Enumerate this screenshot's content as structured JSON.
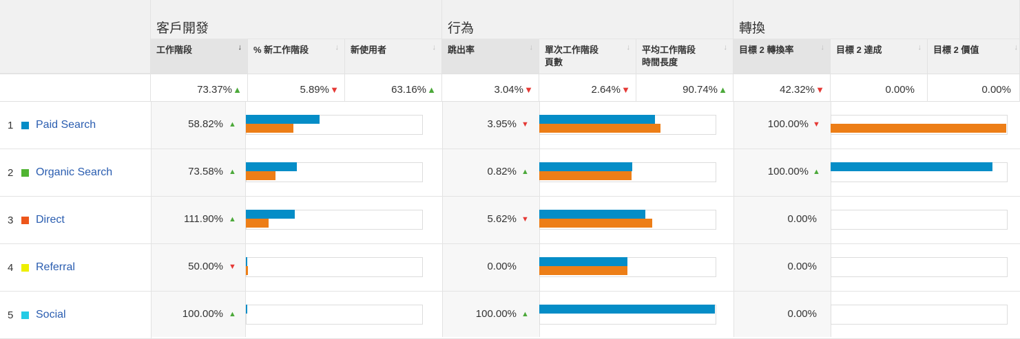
{
  "groups": {
    "acquisition": "客戶開發",
    "behavior": "行為",
    "conversions": "轉換"
  },
  "columns": {
    "sessions": "工作階段",
    "new_sessions_pct": "% 新工作階段",
    "new_users": "新使用者",
    "bounce_rate": "跳出率",
    "pages_per_session": "單次工作階段\n頁數",
    "avg_session_duration": "平均工作階段\n時間長度",
    "goal2_conv_rate": "目標 2 轉換率",
    "goal2_completions": "目標 2 達成",
    "goal2_value": "目標 2 價值"
  },
  "sort_icons": {
    "active": "↓",
    "inactive": "↓"
  },
  "totals": {
    "sessions": "73.37%",
    "sessions_dir": "up",
    "new_sessions_pct": "5.89%",
    "new_sessions_pct_dir": "down",
    "new_users": "63.16%",
    "new_users_dir": "up",
    "bounce_rate": "3.04%",
    "bounce_rate_dir": "down",
    "pages_per_session": "2.64%",
    "pages_per_session_dir": "down",
    "avg_session_duration": "90.74%",
    "avg_session_duration_dir": "up",
    "goal2_conv_rate": "42.32%",
    "goal2_conv_rate_dir": "down",
    "goal2_completions": "0.00%",
    "goal2_value": "0.00%"
  },
  "rows": [
    {
      "index": "1",
      "name": "Paid Search",
      "color": "#058dc7",
      "sessions": "58.82%",
      "sessions_dir": "up",
      "new_sessions_bars": [
        0.42,
        0.27
      ],
      "bounce": "3.95%",
      "bounce_dir": "down",
      "behavior_bars": [
        0.66,
        0.69
      ],
      "conv": "100.00%",
      "conv_dir": "down",
      "goal_bars": [
        0,
        1.0
      ]
    },
    {
      "index": "2",
      "name": "Organic Search",
      "color": "#50b432",
      "sessions": "73.58%",
      "sessions_dir": "up",
      "new_sessions_bars": [
        0.29,
        0.17
      ],
      "bounce": "0.82%",
      "bounce_dir": "up",
      "behavior_bars": [
        0.53,
        0.525
      ],
      "conv": "100.00%",
      "conv_dir": "up",
      "goal_bars": [
        0.92,
        0
      ]
    },
    {
      "index": "3",
      "name": "Direct",
      "color": "#ed561b",
      "sessions": "111.90%",
      "sessions_dir": "up",
      "new_sessions_bars": [
        0.28,
        0.13
      ],
      "bounce": "5.62%",
      "bounce_dir": "down",
      "behavior_bars": [
        0.605,
        0.645
      ],
      "conv": "0.00%",
      "conv_dir": "",
      "goal_bars": [
        0,
        0
      ]
    },
    {
      "index": "4",
      "name": "Referral",
      "color": "#edef00",
      "sessions": "50.00%",
      "sessions_dir": "down",
      "new_sessions_bars": [
        0.006,
        0.013
      ],
      "bounce": "0.00%",
      "bounce_dir": "",
      "behavior_bars": [
        0.5,
        0.5
      ],
      "conv": "0.00%",
      "conv_dir": "",
      "goal_bars": [
        0,
        0
      ]
    },
    {
      "index": "5",
      "name": "Social",
      "color": "#24cbe5",
      "sessions": "100.00%",
      "sessions_dir": "up",
      "new_sessions_bars": [
        0.006,
        0
      ],
      "bounce": "100.00%",
      "bounce_dir": "up",
      "behavior_bars": [
        1.0,
        0
      ],
      "conv": "0.00%",
      "conv_dir": "",
      "goal_bars": [
        0,
        0
      ]
    }
  ]
}
